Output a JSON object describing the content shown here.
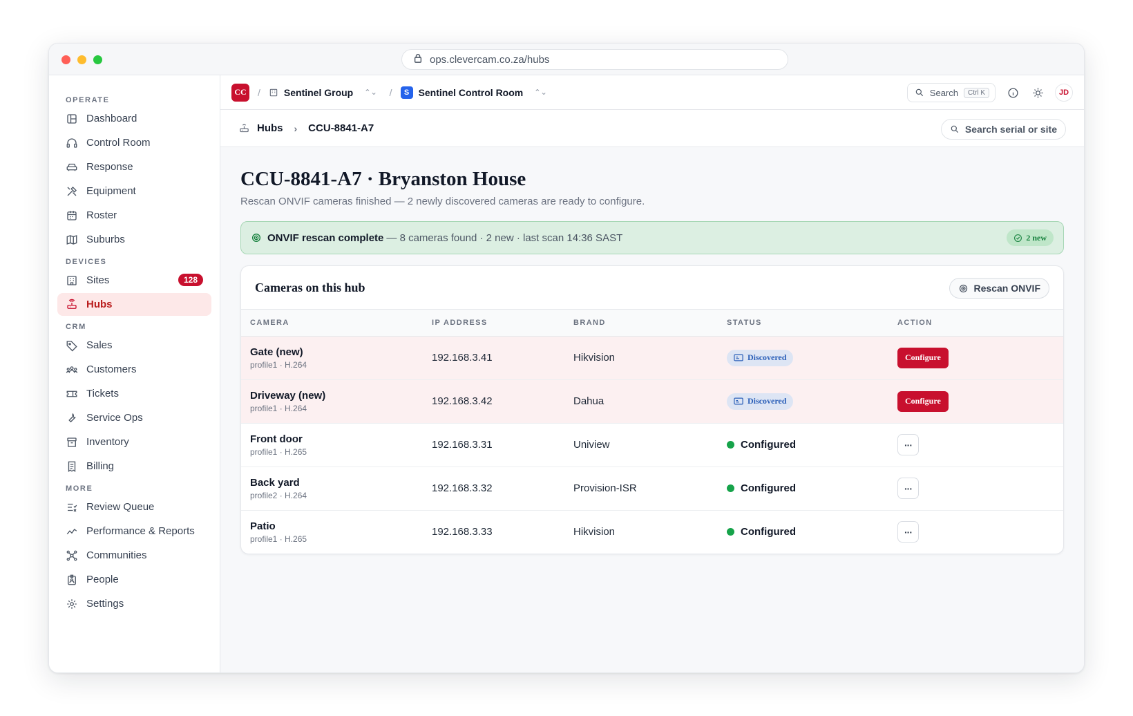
{
  "browser": {
    "url": "ops.clevercam.co.za/hubs"
  },
  "sidebar": {
    "sections": [
      {
        "label": "OPERATE",
        "items": [
          {
            "label": "Dashboard",
            "icon": "layout-icon"
          },
          {
            "label": "Control Room",
            "icon": "headset-icon"
          },
          {
            "label": "Response",
            "icon": "car-icon"
          },
          {
            "label": "Equipment",
            "icon": "tools-icon"
          },
          {
            "label": "Roster",
            "icon": "calendar-icon"
          },
          {
            "label": "Suburbs",
            "icon": "map-icon"
          }
        ]
      },
      {
        "label": "DEVICES",
        "items": [
          {
            "label": "Sites",
            "icon": "building-icon",
            "badge": "128"
          },
          {
            "label": "Hubs",
            "icon": "router-icon",
            "active": true
          }
        ]
      },
      {
        "label": "CRM",
        "items": [
          {
            "label": "Sales",
            "icon": "tag-icon"
          },
          {
            "label": "Customers",
            "icon": "users-icon"
          },
          {
            "label": "Tickets",
            "icon": "ticket-icon"
          },
          {
            "label": "Service Ops",
            "icon": "wrench-icon"
          },
          {
            "label": "Inventory",
            "icon": "archive-icon"
          },
          {
            "label": "Billing",
            "icon": "receipt-icon"
          }
        ]
      },
      {
        "label": "MORE",
        "items": [
          {
            "label": "Review Queue",
            "icon": "list-check-icon"
          },
          {
            "label": "Performance & Reports",
            "icon": "chart-line-icon"
          },
          {
            "label": "Communities",
            "icon": "network-icon"
          },
          {
            "label": "People",
            "icon": "id-badge-icon"
          },
          {
            "label": "Settings",
            "icon": "gear-icon"
          }
        ]
      }
    ]
  },
  "topbar": {
    "logo": "CC",
    "org": "Sentinel Group",
    "workspace_initial": "S",
    "workspace": "Sentinel Control Room",
    "search_label": "Search",
    "search_shortcut": "Ctrl K",
    "avatar": "JD"
  },
  "subbar": {
    "crumb_root": "Hubs",
    "crumb_current": "CCU-8841-A7",
    "search_label": "Search serial or site"
  },
  "page": {
    "title": "CCU-8841-A7 · Bryanston House",
    "subtitle": "Rescan ONVIF cameras finished — 2 newly discovered cameras are ready to configure."
  },
  "banner": {
    "title": "ONVIF rescan complete",
    "detail": "— 8 cameras found · 2 new · last scan 14:36 SAST",
    "pill": "2 new",
    "accent": "#15803d"
  },
  "cameras": {
    "title": "Cameras on this hub",
    "rescan_label": "Rescan ONVIF",
    "columns": [
      "CAMERA",
      "IP ADDRESS",
      "BRAND",
      "STATUS",
      "ACTION"
    ],
    "rows": [
      {
        "name": "Gate (new)",
        "profile": "profile1 · H.264",
        "ip": "192.168.3.41",
        "brand": "Hikvision",
        "status": "Discovered",
        "action": "Configure",
        "new": true
      },
      {
        "name": "Driveway (new)",
        "profile": "profile1 · H.264",
        "ip": "192.168.3.42",
        "brand": "Dahua",
        "status": "Discovered",
        "action": "Configure",
        "new": true
      },
      {
        "name": "Front door",
        "profile": "profile1 · H.265",
        "ip": "192.168.3.31",
        "brand": "Uniview",
        "status": "Configured",
        "action": "···",
        "new": false
      },
      {
        "name": "Back yard",
        "profile": "profile2 · H.264",
        "ip": "192.168.3.32",
        "brand": "Provision-ISR",
        "status": "Configured",
        "action": "···",
        "new": false
      },
      {
        "name": "Patio",
        "profile": "profile1 · H.265",
        "ip": "192.168.3.33",
        "brand": "Hikvision",
        "status": "Configured",
        "action": "···",
        "new": false
      }
    ]
  },
  "colors": {
    "brand": "#c8102e",
    "discovered": "#2b5fb8",
    "configured": "#16a34a"
  }
}
